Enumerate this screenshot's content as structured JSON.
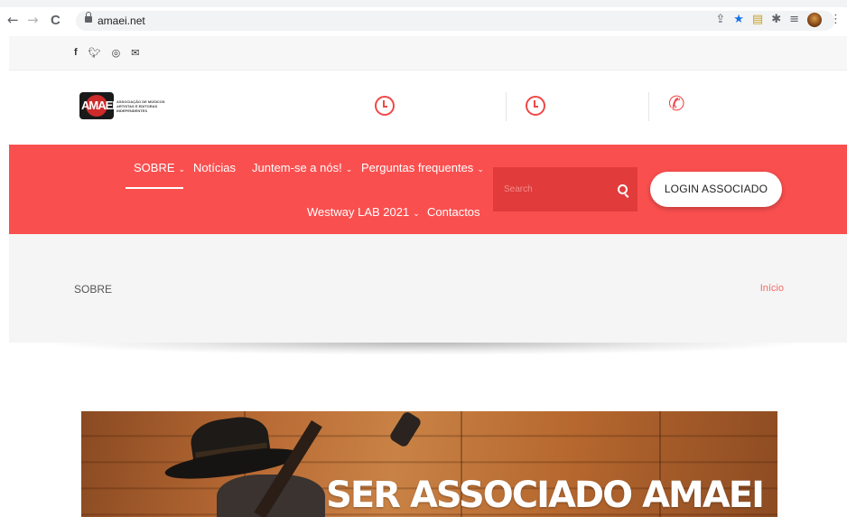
{
  "browser": {
    "url": "amaei.net",
    "nav": {
      "back": "←",
      "forward": "→",
      "reload": "C"
    },
    "extensions": [
      "share-icon",
      "bookmark-star-icon",
      "extension-ledger-icon",
      "puzzle-icon",
      "reading-list-icon",
      "profile-avatar"
    ]
  },
  "social": {
    "facebook": "f",
    "twitter": "🐦",
    "instagram": "◎",
    "email": "✉"
  },
  "header": {
    "logo_text": "AMAEI",
    "logo_subtitle": "ASSOCIAÇÃO DE MÚSICOS ARTISTAS E EDITORAS INDEPENDENTES"
  },
  "nav": {
    "items": [
      {
        "label": "SOBRE",
        "has_dropdown": true,
        "active": true
      },
      {
        "label": "Notícias",
        "has_dropdown": false
      },
      {
        "label": "Juntem-se a nós!",
        "has_dropdown": true
      },
      {
        "label": "Perguntas frequentes",
        "has_dropdown": true
      },
      {
        "label": "Westway LAB 2021",
        "has_dropdown": true
      },
      {
        "label": "Contactos",
        "has_dropdown": false
      }
    ],
    "caret": "⌄",
    "search_placeholder": "Search",
    "login_label": "LOGIN ASSOCIADO"
  },
  "breadcrumb": {
    "title": "SOBRE",
    "home_link": "Início"
  },
  "banner": {
    "title": "SER ASSOCIADO AMAEI"
  },
  "colors": {
    "brand_red": "#fa4f4f",
    "search_bg": "#e13b3b",
    "link_red": "#f36a6a",
    "icon_red": "#f04848"
  }
}
